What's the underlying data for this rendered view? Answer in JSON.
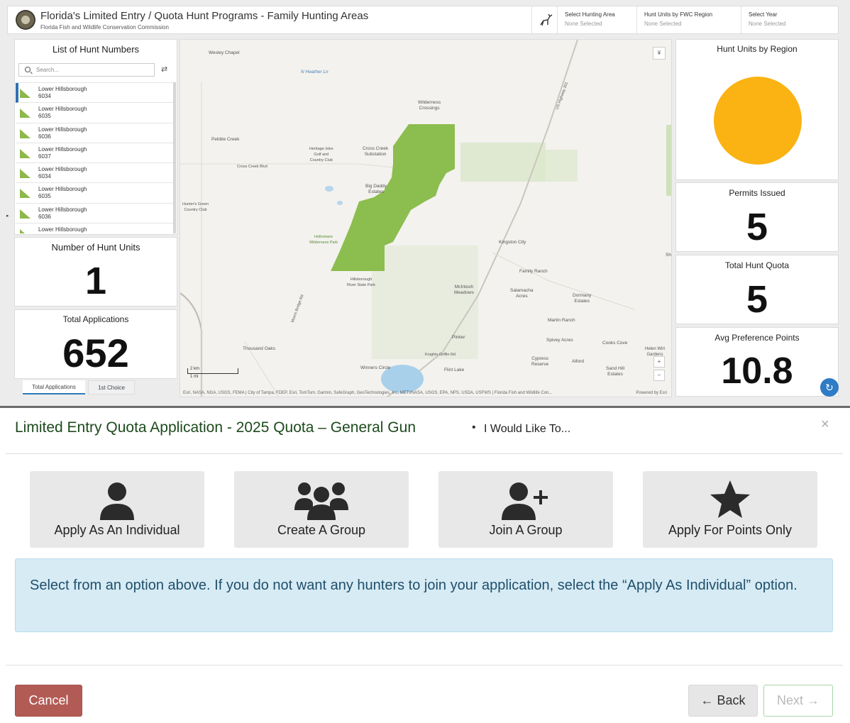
{
  "dashboard": {
    "title": "Florida's Limited Entry / Quota Hunt Programs - Family Hunting Areas",
    "subtitle": "Florida Fish and Wildlife Conservation Commission",
    "selectors": [
      {
        "label": "Select Hunting Area",
        "value": "None Selected"
      },
      {
        "label": "Hunt Units by FWC Region",
        "value": "None Selected"
      },
      {
        "label": "Select Year",
        "value": "None Selected"
      }
    ],
    "hunt_list": {
      "title": "List of Hunt Numbers",
      "search_placeholder": "Search...",
      "items": [
        {
          "name": "Lower Hillsborough",
          "number": "6034"
        },
        {
          "name": "Lower Hillsborough",
          "number": "6035"
        },
        {
          "name": "Lower Hillsborough",
          "number": "6036"
        },
        {
          "name": "Lower Hillsborough",
          "number": "6037"
        },
        {
          "name": "Lower Hillsborough",
          "number": "6034"
        },
        {
          "name": "Lower Hillsborough",
          "number": "6035"
        },
        {
          "name": "Lower Hillsborough",
          "number": "6036"
        },
        {
          "name": "Lower Hillsborough",
          "number": ""
        }
      ]
    },
    "hunt_units": {
      "title": "Number of Hunt Units",
      "value": "1"
    },
    "total_applications": {
      "title": "Total Applications",
      "value": "652"
    },
    "tabs": [
      "Total Applications",
      "1st Choice"
    ],
    "region_chart": {
      "title": "Hunt Units by Region",
      "color": "#fbb213"
    },
    "permits_issued": {
      "title": "Permits Issued",
      "value": "5"
    },
    "total_hunt_quota": {
      "title": "Total Hunt Quota",
      "value": "5"
    },
    "avg_preference_points": {
      "title": "Avg Preference Points",
      "value": "10.8"
    },
    "map": {
      "labels": {
        "wesley_chapel": "Wesley Chapel",
        "pebble_creek": "Pebble Creek",
        "wilderness": "Wilderness\nCrossings",
        "cross_creek_sub": "Cross Creek\nSubstation",
        "heritage": "Heritage Isles\nGolf and\nCountry Club",
        "big_daddy": "Big Daddy\nEstates",
        "kingston": "Kingston City",
        "family_ranch": "Family Ranch",
        "mcintosh": "McIntosh\nMeadows",
        "salamacha": "Salamacha\nAcres",
        "dormany": "Dormany\nEstates",
        "martin_ranch": "Martin Ranch",
        "thousand_oaks": "Thousand Oaks",
        "spivey": "Spivey Acres",
        "cooks_cove": "Cooks Cove",
        "helen_wirt": "Helen Wirt\nGardens",
        "winners_circle": "Winners Circle",
        "flint_lake": "Flint Lake",
        "cypress": "Cypress\nReserve",
        "alford": "Alford",
        "sand_hill": "Sand Hill\nEstates",
        "pinker": "Pinker",
        "hillsborough_park": "Hillsborough\nRiver State Park",
        "hollomans": "Hollomans\nWilderness Park",
        "hunters_green": "Hunter's Green\nCountry Club",
        "cross_creek_blvd": "Cross Creek Blvd",
        "morris_bridge": "Morris Bridge Rd",
        "knights_griffin": "Knights Griffin Rd",
        "us301": "US Highway 301",
        "n_heather": "N Heather Ln",
        "s_hwy": "Sh",
        "scale_km": "2 km",
        "scale_mi": "1 mi",
        "attribution": "Esri, NASA, NGA, USGS, FEMA | City of Tampa, FDEP, Esri, TomTom, Garmin, SafeGraph, GeoTechnologies, Inc, METI/NASA, USGS, EPA, NPS, USDA, USFWS | Florida Fish and Wildlife Con...",
        "powered": "Powered by Esri"
      },
      "area_color": "#8cbd4f"
    }
  },
  "modal": {
    "title": "Limited Entry Quota Application - 2025 Quota – General Gun",
    "separator": "•",
    "subtitle": "I Would Like To...",
    "close": "×",
    "options": [
      {
        "label": "Apply As An Individual",
        "icon": "user-icon"
      },
      {
        "label": "Create A Group",
        "icon": "group-icon"
      },
      {
        "label": "Join A Group",
        "icon": "user-plus-icon"
      },
      {
        "label": "Apply For Points Only",
        "icon": "star-icon"
      }
    ],
    "info": "Select from an option above. If you do not want any hunters to join your application, select the “Apply As Individual” option.",
    "buttons": {
      "cancel": "Cancel",
      "back": "← Back",
      "next": "Next →"
    },
    "colors": {
      "cancel": "#b25b55",
      "info_bg": "#d7ebf5",
      "title": "#1d4a1d"
    }
  }
}
